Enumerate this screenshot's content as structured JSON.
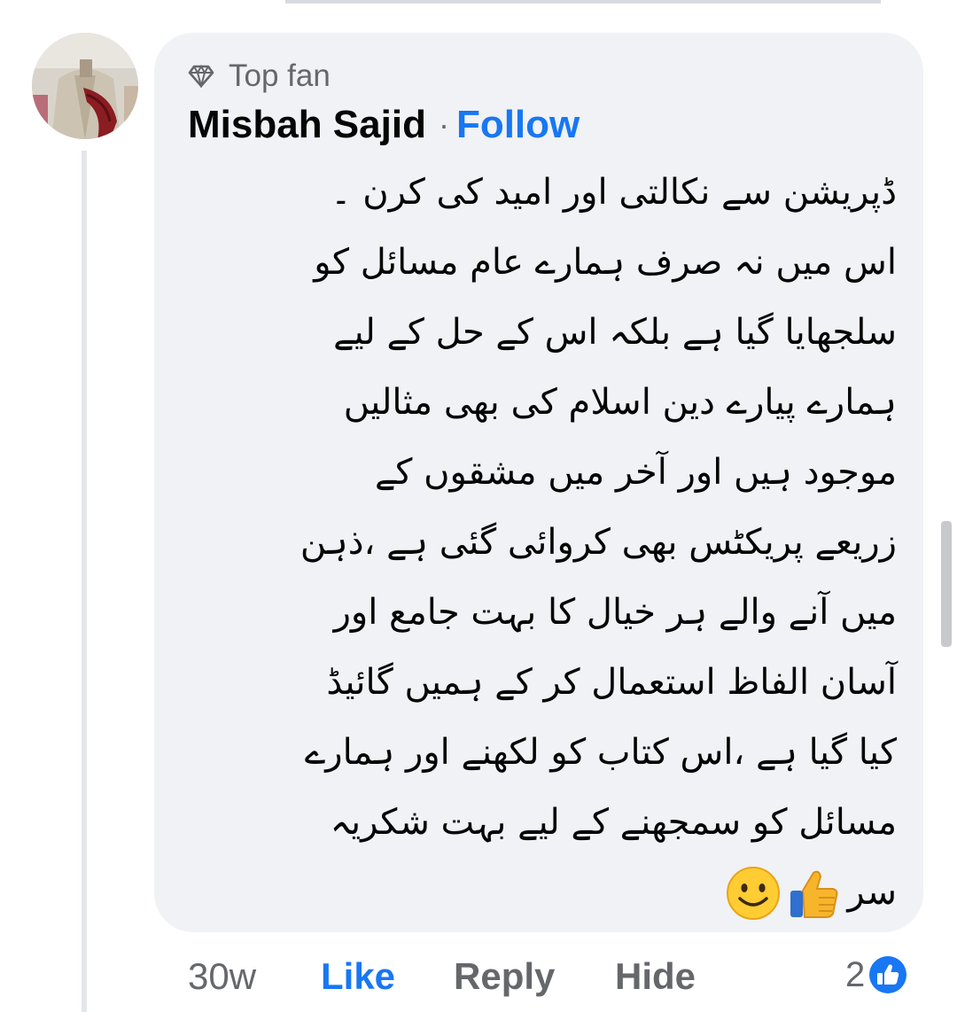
{
  "comment": {
    "badge": "Top fan",
    "author": "Misbah Sajid",
    "separator": "·",
    "follow_label": "Follow",
    "body_lines": [
      "ڈپریشن سے نکالتی اور  امید کی کرن ۔",
      "اس میں نہ صرف ہمارے عام مسائل کو",
      "سلجھایا گیا ہے بلکہ اس کے حل کے لیے",
      "ہمارے پیارے دین اسلام کی بھی مثالیں",
      "موجود ہیں اور آخر میں مشقوں کے",
      "زریعے پریکٹس بھی کروائی گئی ہے ،ذہن",
      "میں آنے والے ہر خیال کا بہت جامع اور",
      "آسان الفاظ استعمال کر کے  ہمیں گائیڈ",
      "کیا گیا ہے ،اس کتاب کو لکھنے اور ہمارے",
      "مسائل کو سمجھنے کے لیے بہت شکریہ"
    ],
    "last_line_text": "سر",
    "emojis": [
      "thumbs-up-emoji",
      "smiling-face-emoji"
    ]
  },
  "actions": {
    "time": "30w",
    "like_label": "Like",
    "reply_label": "Reply",
    "hide_label": "Hide"
  },
  "reactions": {
    "count": "2",
    "icon": "like-reaction-icon"
  },
  "colors": {
    "link_blue": "#1877f2",
    "bubble_bg": "#f0f2f5",
    "secondary_text": "#65676b",
    "primary_text": "#050505"
  }
}
